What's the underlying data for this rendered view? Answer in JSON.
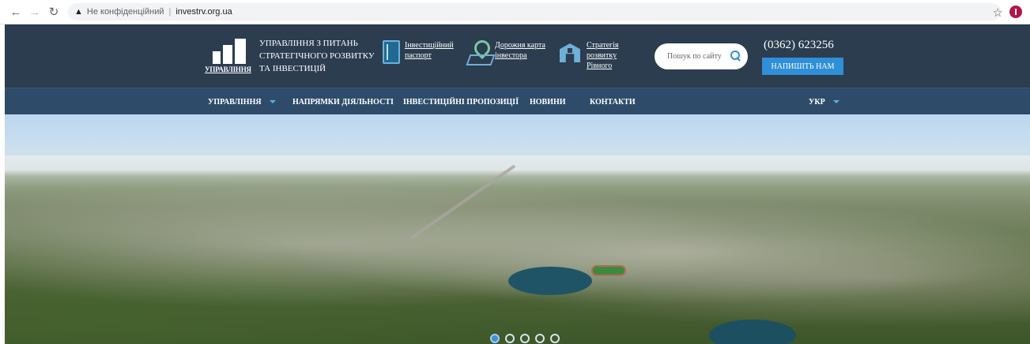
{
  "browser": {
    "security_warning": "Не конфіденційний",
    "url": "investrv.org.ua",
    "icons": {
      "back": "arrow-left-icon",
      "forward": "arrow-right-icon",
      "reload": "reload-icon",
      "warning": "warning-triangle-icon",
      "bookmark": "star-icon",
      "profile": "profile-avatar-icon"
    }
  },
  "header": {
    "logo_text": "УПРАВЛІННЯ",
    "org_name": "УПРАВЛІННЯ З ПИТАНЬ СТРАТЕГІЧНОГО РОЗВИТКУ ТА ІНВЕСТИЦІЙ",
    "quick_links": [
      {
        "label": "Інвестиційний паспорт",
        "icon": "document-icon"
      },
      {
        "label": "Дорожня карта інвестора",
        "icon": "map-pin-icon"
      },
      {
        "label": "Стратегія розвитку Рівного",
        "icon": "city-gate-icon"
      }
    ],
    "search_placeholder": "Пошук по сайту",
    "phone": "(0362) 623256",
    "write_button": "НАПИШІТЬ НАМ"
  },
  "nav": {
    "items": [
      {
        "label": "УПРАВЛІННЯ",
        "has_dropdown": true
      },
      {
        "label": "НАПРЯМКИ ДІЯЛЬНОСТІ",
        "has_dropdown": false
      },
      {
        "label": "ІНВЕСТИЦІЙНІ ПРОПОЗИЦІЇ",
        "has_dropdown": false
      },
      {
        "label": "НОВИНИ",
        "has_dropdown": false
      },
      {
        "label": "КОНТАКТИ",
        "has_dropdown": false
      }
    ],
    "language": "Укр"
  },
  "hero": {
    "slider_dots": 5,
    "active_slide": 1
  },
  "colors": {
    "header_bg": "#2b3d4f",
    "nav_bg": "#2e4c6a",
    "accent": "#2f8fd8"
  }
}
